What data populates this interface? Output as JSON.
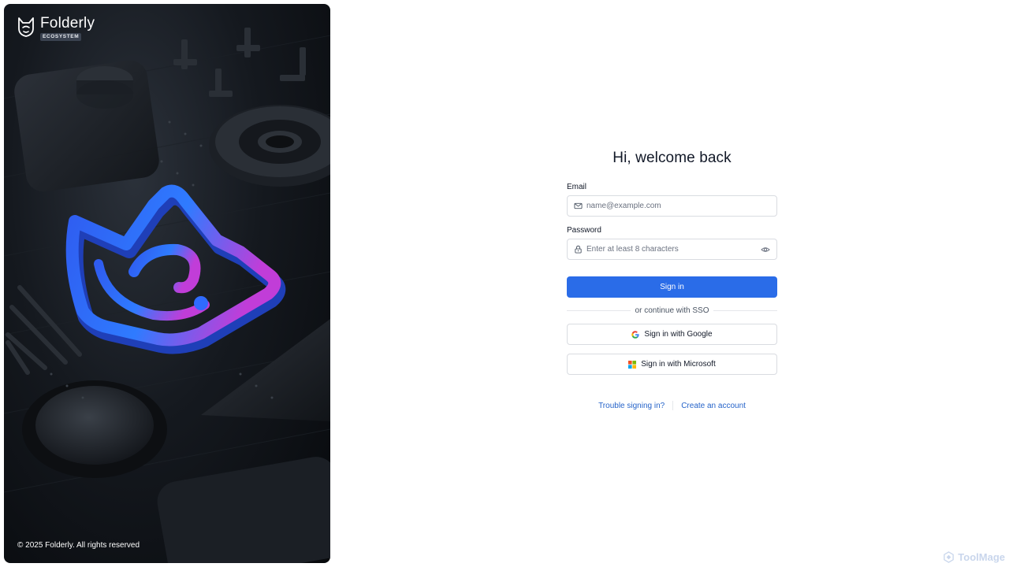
{
  "brand": {
    "name": "Folderly",
    "tag": "ECOSYSTEM",
    "logo_icon": "fox-head-icon"
  },
  "hero": {
    "copyright": "© 2025 Folderly. All rights reserved"
  },
  "login": {
    "title": "Hi, welcome back",
    "email": {
      "label": "Email",
      "placeholder": "name@example.com",
      "value": "",
      "icon": "mail-icon"
    },
    "password": {
      "label": "Password",
      "placeholder": "Enter at least 8 characters",
      "value": "",
      "icon": "lock-icon",
      "toggle_icon": "eye-icon"
    },
    "submit_label": "Sign in",
    "divider_text": "or continue with SSO",
    "sso": [
      {
        "label": "Sign in with Google",
        "icon": "google-icon"
      },
      {
        "label": "Sign in with Microsoft",
        "icon": "microsoft-icon"
      }
    ],
    "links": {
      "trouble": "Trouble signing in?",
      "create": "Create an account"
    }
  },
  "watermark": {
    "text": "ToolMage",
    "icon": "toolmage-logo-icon"
  },
  "colors": {
    "primary": "#2a6ce8",
    "link": "#2563c9",
    "hero_bg": "#0d1014",
    "logo_gradient_start": "#2f6bff",
    "logo_gradient_end": "#c13dd8"
  }
}
